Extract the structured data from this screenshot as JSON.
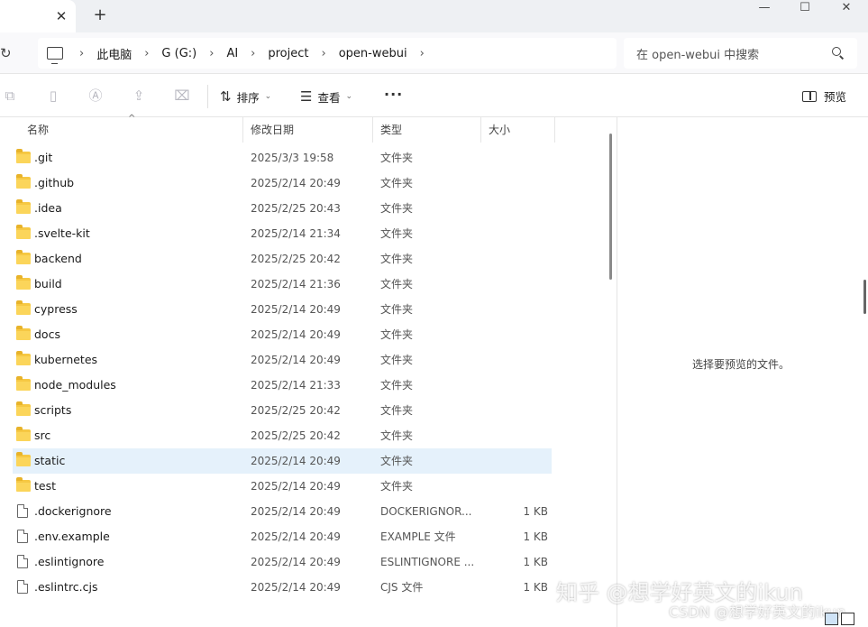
{
  "window": {
    "tab_close_glyph": "✕",
    "new_tab_glyph": "+",
    "minimize_glyph": "—",
    "maximize_glyph": "☐",
    "close_glyph": "✕"
  },
  "address": {
    "refresh_glyph": "↻",
    "separator": "›",
    "crumbs": [
      "此电脑",
      "G (G:)",
      "AI",
      "project",
      "open-webui"
    ]
  },
  "search": {
    "placeholder": "在 open-webui 中搜索"
  },
  "toolbar": {
    "sort_label": "排序",
    "view_label": "查看",
    "more_label": "···",
    "preview_label": "预览"
  },
  "columns": {
    "name": "名称",
    "date": "修改日期",
    "type": "类型",
    "size": "大小"
  },
  "files": [
    {
      "name": ".git",
      "date": "2025/3/3 19:58",
      "type": "文件夹",
      "size": "",
      "kind": "folder"
    },
    {
      "name": ".github",
      "date": "2025/2/14 20:49",
      "type": "文件夹",
      "size": "",
      "kind": "folder"
    },
    {
      "name": ".idea",
      "date": "2025/2/25 20:43",
      "type": "文件夹",
      "size": "",
      "kind": "folder"
    },
    {
      "name": ".svelte-kit",
      "date": "2025/2/14 21:34",
      "type": "文件夹",
      "size": "",
      "kind": "folder"
    },
    {
      "name": "backend",
      "date": "2025/2/25 20:42",
      "type": "文件夹",
      "size": "",
      "kind": "folder"
    },
    {
      "name": "build",
      "date": "2025/2/14 21:36",
      "type": "文件夹",
      "size": "",
      "kind": "folder"
    },
    {
      "name": "cypress",
      "date": "2025/2/14 20:49",
      "type": "文件夹",
      "size": "",
      "kind": "folder"
    },
    {
      "name": "docs",
      "date": "2025/2/14 20:49",
      "type": "文件夹",
      "size": "",
      "kind": "folder"
    },
    {
      "name": "kubernetes",
      "date": "2025/2/14 20:49",
      "type": "文件夹",
      "size": "",
      "kind": "folder"
    },
    {
      "name": "node_modules",
      "date": "2025/2/14 21:33",
      "type": "文件夹",
      "size": "",
      "kind": "folder"
    },
    {
      "name": "scripts",
      "date": "2025/2/25 20:42",
      "type": "文件夹",
      "size": "",
      "kind": "folder"
    },
    {
      "name": "src",
      "date": "2025/2/25 20:42",
      "type": "文件夹",
      "size": "",
      "kind": "folder"
    },
    {
      "name": "static",
      "date": "2025/2/14 20:49",
      "type": "文件夹",
      "size": "",
      "kind": "folder",
      "selected": true
    },
    {
      "name": "test",
      "date": "2025/2/14 20:49",
      "type": "文件夹",
      "size": "",
      "kind": "folder"
    },
    {
      "name": ".dockerignore",
      "date": "2025/2/14 20:49",
      "type": "DOCKERIGNOR...",
      "size": "1 KB",
      "kind": "file"
    },
    {
      "name": ".env.example",
      "date": "2025/2/14 20:49",
      "type": "EXAMPLE 文件",
      "size": "1 KB",
      "kind": "file"
    },
    {
      "name": ".eslintignore",
      "date": "2025/2/14 20:49",
      "type": "ESLINTIGNORE ...",
      "size": "1 KB",
      "kind": "file"
    },
    {
      "name": ".eslintrc.cjs",
      "date": "2025/2/14 20:49",
      "type": "CJS 文件",
      "size": "1 KB",
      "kind": "file"
    }
  ],
  "preview_pane": {
    "message": "选择要预览的文件。"
  },
  "watermark": {
    "line1": "知乎 @想学好英文的ikun",
    "line2": "CSDN @想学好英文的ikun"
  }
}
